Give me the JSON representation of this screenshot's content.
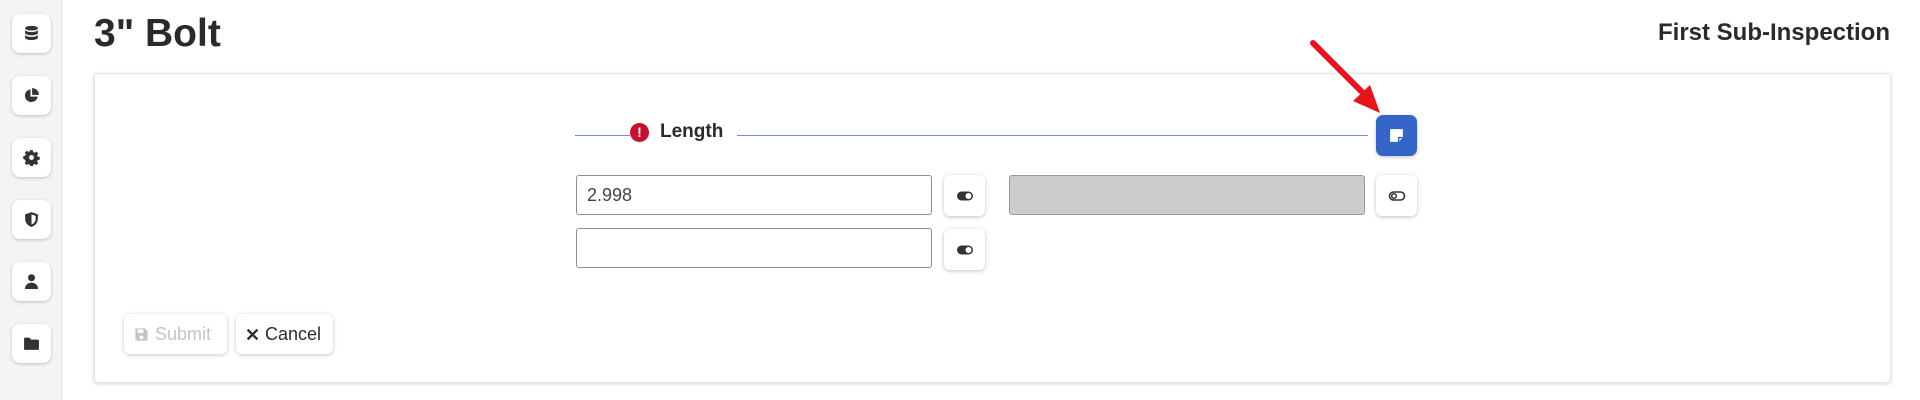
{
  "sidebar": {
    "items": [
      {
        "icon": "database-icon"
      },
      {
        "icon": "pie-chart-icon"
      },
      {
        "icon": "gear-icon"
      },
      {
        "icon": "shield-icon"
      },
      {
        "icon": "user-icon"
      },
      {
        "icon": "folder-icon"
      }
    ]
  },
  "header": {
    "title": "3\" Bolt",
    "subtitle": "First Sub-Inspection"
  },
  "section": {
    "label": "Length",
    "status_icon": "error-icon",
    "note_icon": "sticky-note-icon"
  },
  "inputs": {
    "measurement_1": {
      "value": "2.998"
    },
    "measurement_2": {
      "value": ""
    },
    "reference": {
      "value": ""
    }
  },
  "actions": {
    "submit_label": "Submit",
    "cancel_label": "Cancel"
  },
  "colors": {
    "accent": "#3565c9",
    "error": "#c8102e",
    "annotation_arrow": "#e8141c",
    "disabled_field": "#cccccc"
  }
}
